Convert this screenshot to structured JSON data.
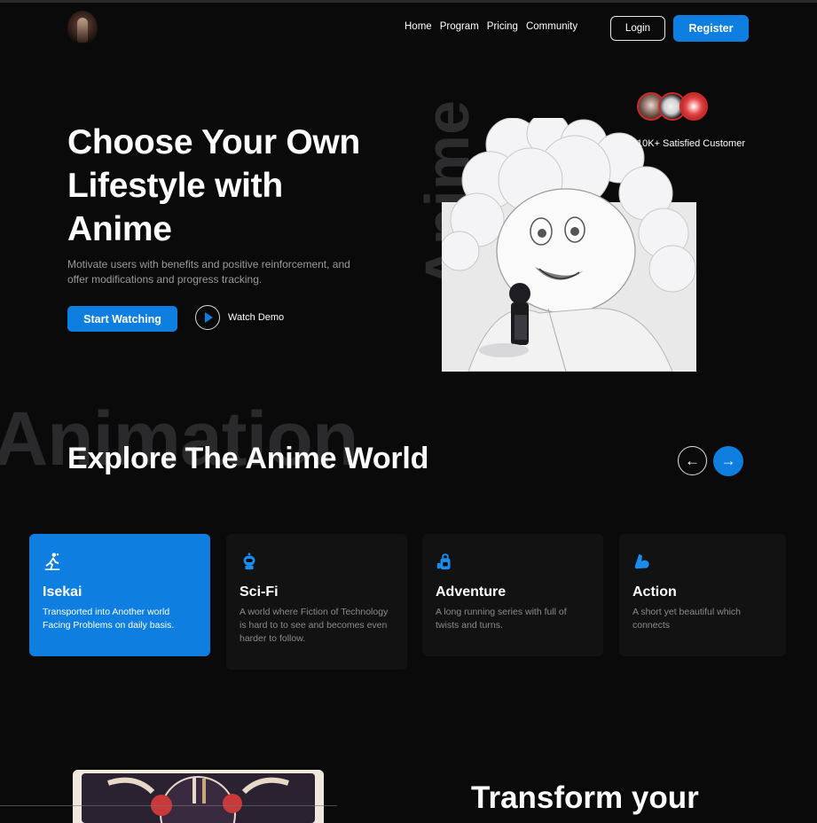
{
  "nav": {
    "links": [
      "Home",
      "Program",
      "Pricing",
      "Community"
    ],
    "login_label": "Login",
    "register_label": "Register"
  },
  "hero": {
    "title": "Choose Your Own Lifestyle with Anime",
    "description": "Motivate users with benefits and positive reinforcement, and offer modifications and progress tracking.",
    "start_label": "Start Watching",
    "demo_label": "Watch Demo",
    "watermark": "Anime",
    "customers_text": "10K+ Satisfied Customer"
  },
  "explore": {
    "watermark": "Animation",
    "title": "Explore The Anime World",
    "prev_icon": "arrow-left-icon",
    "next_icon": "arrow-right-icon",
    "cards": [
      {
        "title": "Isekai",
        "description": "Transported into Another world Facing Problems on daily basis.",
        "icon": "hiker-icon",
        "active": true
      },
      {
        "title": "Sci-Fi",
        "description": "A world where Fiction of Technology is hard to to see and becomes even harder to follow.",
        "icon": "robot-icon",
        "active": false
      },
      {
        "title": "Adventure",
        "description": "A long running series with full of twists and turns.",
        "icon": "backpack-icon",
        "active": false
      },
      {
        "title": "Action",
        "description": "A short yet beautiful which connects",
        "icon": "flexed-arm-icon",
        "active": false
      }
    ]
  },
  "bottom": {
    "title": "Transform your"
  },
  "colors": {
    "accent": "#0e7fe1",
    "background": "#0b0a0b",
    "card": "#121213"
  }
}
